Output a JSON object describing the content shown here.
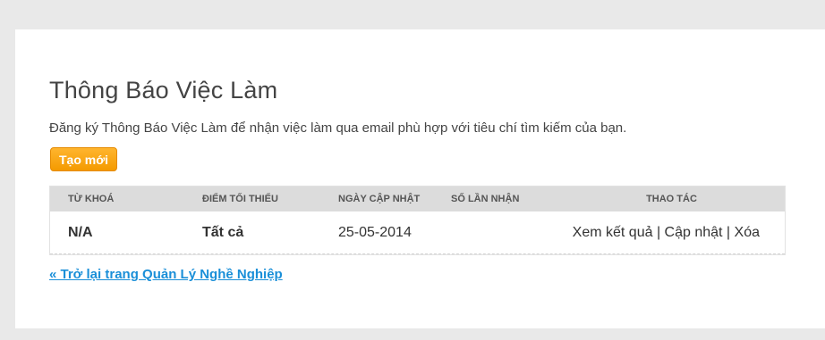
{
  "page": {
    "title": "Thông Báo Việc Làm",
    "description": "Đăng ký Thông Báo Việc Làm để nhận việc làm qua email phù hợp với tiêu chí tìm kiếm của bạn.",
    "create_button": "Tạo mới",
    "back_link": "« Trở lại trang Quản Lý Nghề Nghiệp"
  },
  "table": {
    "headers": [
      "TỪ KHOÁ",
      "ĐIỂM TỐI THIỂU",
      "NGÀY CẬP NHẬT",
      "SỐ LẦN NHẬN",
      "THAO TÁC"
    ],
    "rows": [
      {
        "keyword": "N/A",
        "min_score": "Tất cả",
        "updated": "25-05-2014",
        "times": "",
        "actions": {
          "view": "Xem kết quả",
          "update": "Cập nhật",
          "delete": "Xóa",
          "separator": " | "
        }
      }
    ]
  },
  "colors": {
    "background": "#e9e9e9",
    "button": "#f49a00",
    "link": "#1a8fd8",
    "header": "#dcdcdc"
  }
}
